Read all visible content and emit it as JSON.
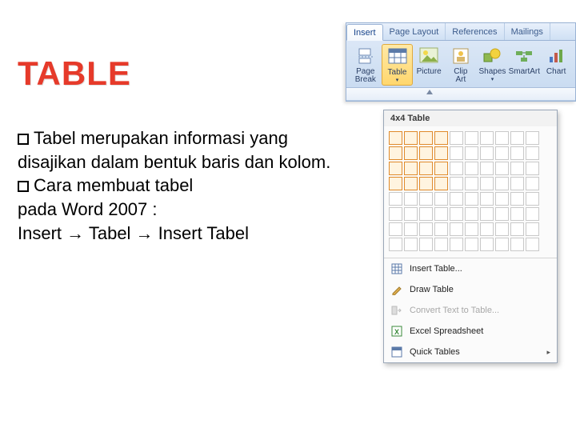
{
  "title": "TABLE",
  "body": {
    "p1a": "Tabel",
    "p1b": " merupakan informasi yang disajikan dalam bentuk baris dan kolom.",
    "p2a": "Cara",
    "p2b": " membuat tabel",
    "p3": "pada Word 2007  :",
    "p4": "Insert  → Tabel → Insert Tabel"
  },
  "ribbon": {
    "tabs": [
      "Insert",
      "Page Layout",
      "References",
      "Mailings"
    ],
    "active_tab": "Insert",
    "buttons": {
      "page_break": {
        "l1": "Page",
        "l2": "Break"
      },
      "table": "Table",
      "picture": "Picture",
      "clip_art": {
        "l1": "Clip",
        "l2": "Art"
      },
      "shapes": "Shapes",
      "smartart": "SmartArt",
      "chart": "Chart"
    }
  },
  "dropdown": {
    "header": "4x4 Table",
    "grid": {
      "cols": 10,
      "rows": 8,
      "sel_cols": 4,
      "sel_rows": 4
    },
    "items": {
      "insert_table": "Insert Table...",
      "draw_table": "Draw Table",
      "convert": "Convert Text to Table...",
      "excel": "Excel Spreadsheet",
      "quick": "Quick Tables"
    }
  }
}
